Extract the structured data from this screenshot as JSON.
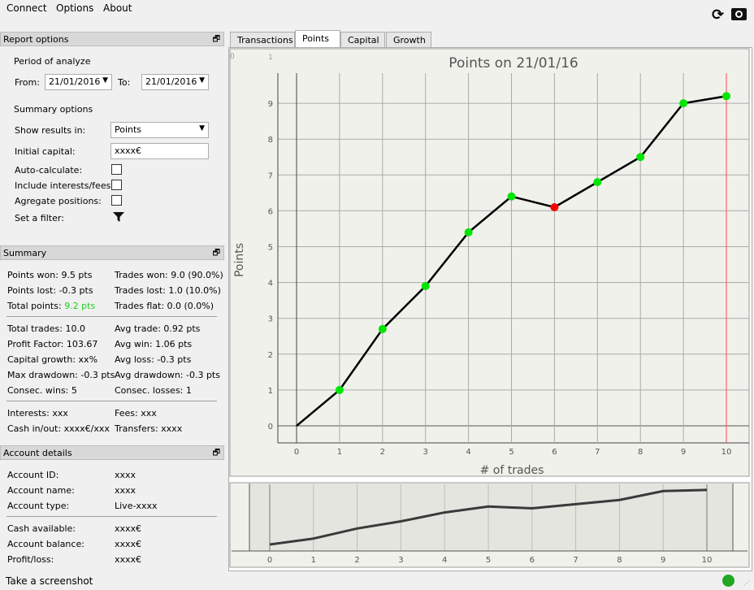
{
  "menu": {
    "connect": "Connect",
    "options": "Options",
    "about": "About"
  },
  "report": {
    "title": "Report options",
    "period_label": "Period of analyze",
    "from_label": "From:",
    "from_value": "21/01/2016",
    "to_label": "To:",
    "to_value": "21/01/2016",
    "summary_options": "Summary options",
    "show_results_label": "Show results in:",
    "show_results_value": "Points",
    "initial_capital_label": "Initial capital:",
    "initial_capital_value": "xxxx€",
    "auto_calc": "Auto-calculate:",
    "include_fees": "Include interests/fees:",
    "aggregate": "Agregate positions:",
    "filter": "Set a filter:"
  },
  "summary": {
    "title": "Summary",
    "points_won": "Points won: 9.5 pts",
    "trades_won": "Trades won: 9.0 (90.0%)",
    "points_lost": "Points lost: -0.3 pts",
    "trades_lost": "Trades lost: 1.0 (10.0%)",
    "total_points_label": "Total points: ",
    "total_points_value": "9.2 pts",
    "trades_flat": "Trades flat: 0.0 (0.0%)",
    "total_trades": "Total trades: 10.0",
    "avg_trade": "Avg trade: 0.92 pts",
    "profit_factor": "Profit Factor: 103.67",
    "avg_win": "Avg win: 1.06 pts",
    "capital_growth": "Capital growth: xx%",
    "avg_loss": "Avg loss: -0.3 pts",
    "max_drawdown": "Max drawdown: -0.3 pts",
    "avg_drawdown": "Avg drawdown: -0.3 pts",
    "consec_wins": "Consec. wins: 5",
    "consec_losses": "Consec. losses: 1",
    "interests": "Interests: xxx",
    "fees": "Fees: xxx",
    "cash_inout": "Cash in/out: xxxx€/xxx",
    "transfers": "Transfers: xxxx"
  },
  "account": {
    "title": "Account details",
    "id_label": "Account ID:",
    "id_value": "xxxx",
    "name_label": "Account name:",
    "name_value": "xxxx",
    "type_label": "Account type:",
    "type_value": "Live-xxxx",
    "cash_label": "Cash available:",
    "cash_value": "xxxx€",
    "balance_label": "Account balance:",
    "balance_value": "xxxx€",
    "pl_label": "Profit/loss:",
    "pl_value": "xxxx€"
  },
  "tabs": [
    "Transactions",
    "Points",
    "Capital",
    "Growth"
  ],
  "status": {
    "text": "Take a screenshot",
    "indicator_color": "#22a722"
  },
  "colors": {
    "win": "#00e600",
    "loss": "#ff0000",
    "total_points": "#22cc22"
  },
  "chart_data": {
    "type": "line",
    "title": "Points on 21/01/16",
    "xlabel": "# of trades",
    "ylabel": "Points",
    "x": [
      0,
      1,
      2,
      3,
      4,
      5,
      6,
      7,
      8,
      9,
      10
    ],
    "values": [
      0,
      1.0,
      2.7,
      3.9,
      5.4,
      6.4,
      6.1,
      6.8,
      7.5,
      9.0,
      9.2
    ],
    "marker_types": [
      "none",
      "win",
      "win",
      "win",
      "win",
      "win",
      "loss",
      "win",
      "win",
      "win",
      "win"
    ],
    "xlim": [
      -0.4,
      10.5
    ],
    "ylim": [
      -0.5,
      9.8
    ],
    "xticks": [
      "0",
      "1",
      "2",
      "3",
      "4",
      "5",
      "6",
      "7",
      "8",
      "9",
      "10"
    ],
    "yticks": [
      "0",
      "1",
      "2",
      "3",
      "4",
      "5",
      "6",
      "7",
      "8",
      "9"
    ],
    "corner_labels": [
      "0",
      "1"
    ],
    "grid": true
  }
}
